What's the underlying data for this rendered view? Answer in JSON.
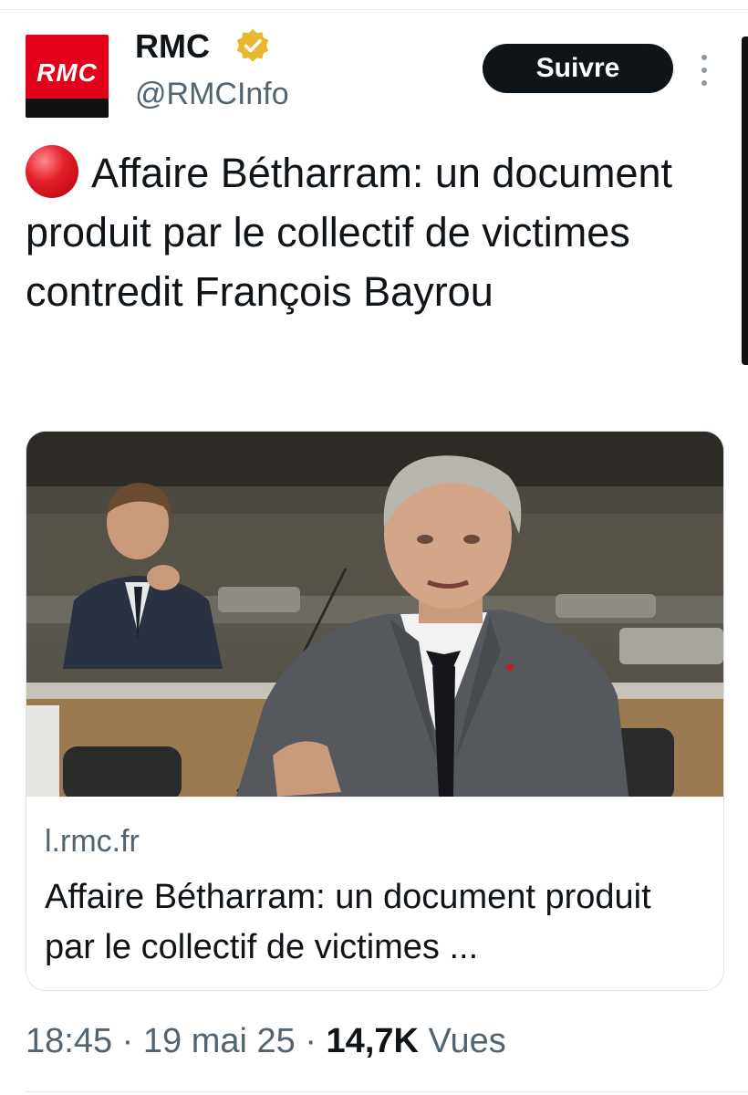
{
  "account": {
    "name": "RMC",
    "handle": "@RMCInfo",
    "avatar_text": "RMC",
    "verified": true,
    "verified_color": "#e8b730"
  },
  "follow_label": "Suivre",
  "tweet": {
    "emoji": "red-circle",
    "text": "Affaire Bétharram: un document produit par le collectif de victimes contredit François Bayrou"
  },
  "card": {
    "image_description_icon": "photo-thumbnail",
    "domain": "l.rmc.fr",
    "title": "Affaire Bétharram: un document produit par le collectif de victimes ..."
  },
  "meta": {
    "time": "18:45",
    "separator": "·",
    "date": "19 mai 25",
    "views_count": "14,7K",
    "views_label": "Vues"
  },
  "colors": {
    "brand_red": "#e2001a",
    "follow_bg": "#0f1419",
    "secondary_text": "#536471"
  }
}
